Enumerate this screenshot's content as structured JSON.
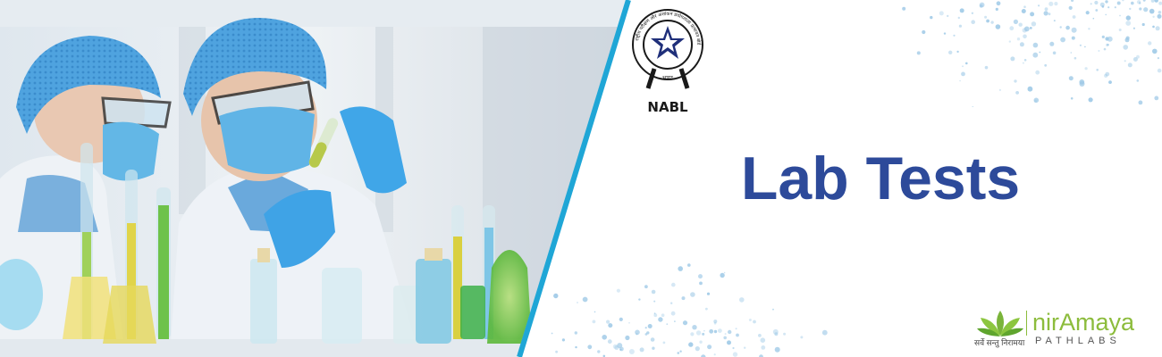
{
  "headline": "Lab Tests",
  "accreditation": {
    "text": "NABL",
    "ring_text": "राष्ट्रीय परीक्षण और अंशांकन प्रयोगशाला प्रत्यायन बोर्ड",
    "bottom_text": "भारत",
    "icon": "nabl-seal-icon"
  },
  "brand": {
    "name": "nirAmaya",
    "subtitle": "PATHLABS",
    "tagline": "सर्वे सन्तु निरामया",
    "icon": "lotus-icon"
  },
  "colors": {
    "headline": "#2d4a9a",
    "divider": "#1fa6d6",
    "brand_green": "#8cbc3c",
    "dots": "#9cc8e6"
  }
}
